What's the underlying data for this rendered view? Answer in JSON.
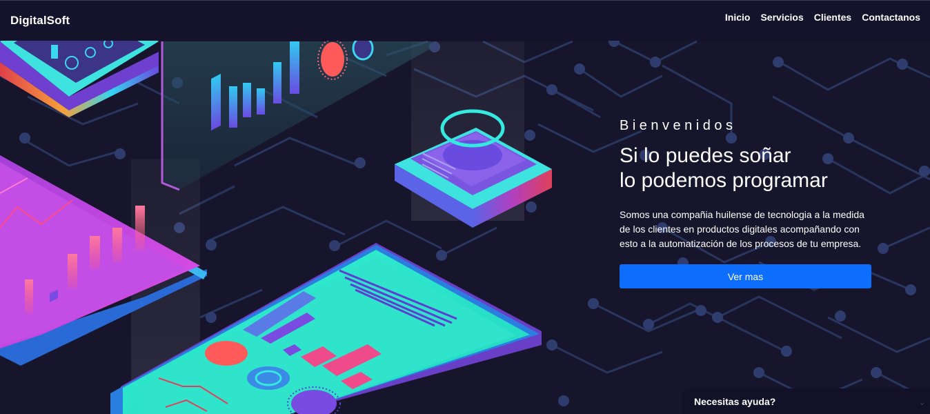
{
  "brand": {
    "name": "DigitalSoft"
  },
  "nav": {
    "items": [
      "Inicio",
      "Servicios",
      "Clientes",
      "Contactanos"
    ]
  },
  "hero": {
    "eyebrow": "Bienvenidos",
    "headline_line1": "Si lo puedes soñar",
    "headline_line2": "lo podemos programar",
    "description": "Somos una compañia huilense de tecnologia a la medida de los clientes en productos digitales acompañando con esto a la automatización de los procesos de tu empresa.",
    "cta_label": "Ver mas"
  },
  "help": {
    "label": "Necesitas ayuda?",
    "icon": "chevron-down-icon"
  },
  "colors": {
    "accent": "#0d6efd",
    "nav_bg": "#15132c",
    "hero_bg": "#17152b",
    "circuit": "#2c3a63",
    "teal": "#2ee6c8",
    "magenta": "#c043e0"
  }
}
